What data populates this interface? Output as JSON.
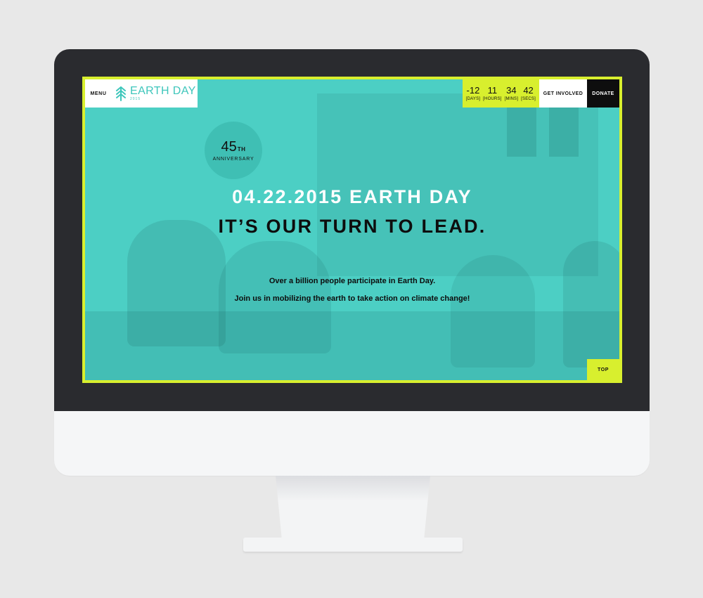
{
  "header": {
    "menu_label": "MENU",
    "logo": {
      "title": "EARTH DAY",
      "year": "2015",
      "icon": "tree-icon",
      "color": "#3ec6bb"
    },
    "countdown": [
      {
        "value": "-12",
        "label": "[DAYS]"
      },
      {
        "value": "11",
        "label": "[HOURS]"
      },
      {
        "value": "34",
        "label": "[MINS]"
      },
      {
        "value": "42",
        "label": "[SECS]"
      }
    ],
    "get_involved_label": "GET INVOLVED",
    "donate_label": "DONATE"
  },
  "badge": {
    "number": "45",
    "suffix": "TH",
    "label": "ANNIVERSARY"
  },
  "hero": {
    "headline_1": "04.22.2015 EARTH DAY",
    "headline_2": "IT’S OUR TURN TO LEAD.",
    "subtext_1": "Over a billion people participate in Earth Day.",
    "subtext_2": "Join us in mobilizing the earth to take action on climate change!"
  },
  "top_label": "TOP",
  "colors": {
    "accent_lime": "#d8ef2e",
    "hero_teal": "#4ccfc4",
    "bezel": "#2a2b2f"
  }
}
